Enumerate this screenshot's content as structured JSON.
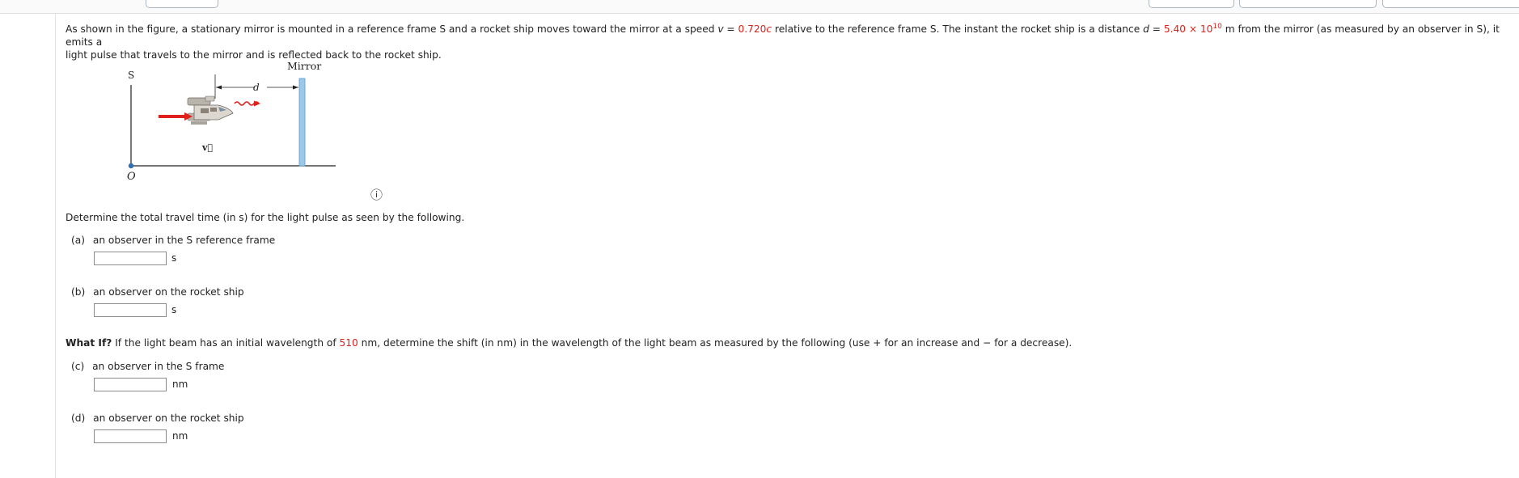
{
  "problem": {
    "intro_1": "As shown in the figure, a stationary mirror is mounted in a reference frame S and a rocket ship moves toward the mirror at a speed ",
    "v_symbol": "v",
    "equals": " = ",
    "v_value": "0.720",
    "v_c": "c",
    "intro_2": " relative to the reference frame S. The instant the rocket ship is a distance ",
    "d_symbol": "d",
    "d_value": "5.40 × 10",
    "d_exp": "10",
    "intro_3": " m from the mirror (as measured by an observer in S), it emits a",
    "intro_line2": "light pulse that travels to the mirror and is reflected back to the rocket ship."
  },
  "figure": {
    "label_mirror": "Mirror",
    "label_S": "S",
    "label_O": "O",
    "label_d": "d",
    "label_v": "v⃗",
    "info_icon": "ⓘ"
  },
  "question": "Determine the total travel time (in s) for the light pulse as seen by the following.",
  "parts": [
    {
      "tag": "(a)",
      "text": "an observer in the S reference frame",
      "unit": "s",
      "value": ""
    },
    {
      "tag": "(b)",
      "text": "an observer on the rocket ship",
      "unit": "s",
      "value": ""
    },
    {
      "tag": "(c)",
      "text": "an observer in the S frame",
      "unit": "nm",
      "value": ""
    },
    {
      "tag": "(d)",
      "text": "an observer on the rocket ship",
      "unit": "nm",
      "value": ""
    }
  ],
  "whatif": {
    "label": "What If?",
    "text_1": " If the light beam has an initial wavelength of ",
    "wavelength": "510",
    "text_2": " nm, determine the shift (in nm) in the wavelength of the light beam as measured by the following (use + for an increase and − for a decrease)."
  },
  "colors": {
    "accent_red": "#e0201b",
    "mirror_blue": "#9cc8e6",
    "origin_blue": "#2f6fb6"
  }
}
